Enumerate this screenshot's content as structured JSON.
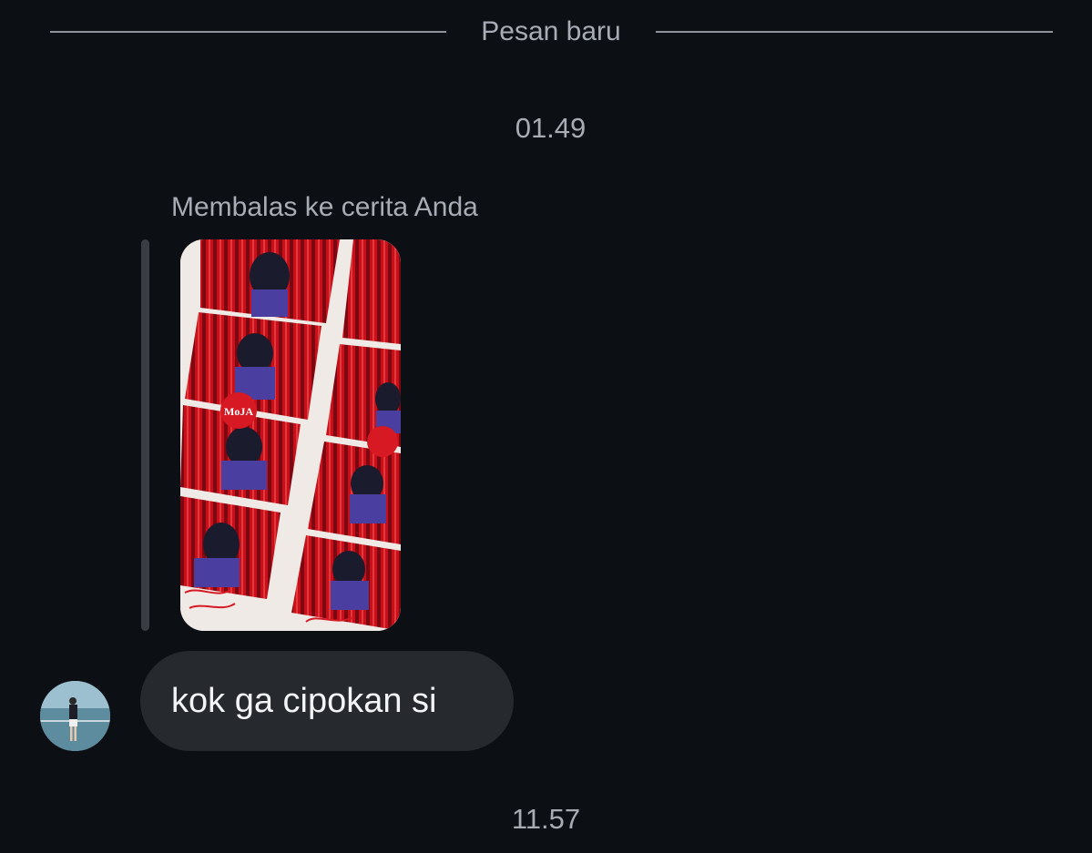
{
  "chat": {
    "new_messages_divider": "Pesan baru",
    "first_timestamp": "01.49",
    "reply_caption": "Membalas ke cerita Anda",
    "story_reply": {
      "story_thumbnail": "photobooth-strip-image",
      "story_overlay_text": "MoJA",
      "message_text": "kok ga cipokan si"
    },
    "second_timestamp": "11.57"
  },
  "colors": {
    "background": "#0c0f14",
    "secondary_text": "#a8adb5",
    "bubble": "#26292e",
    "bubble_text": "#f3f4f6",
    "reply_bar": "#3a3d43",
    "curtain_red": "#c8101c"
  },
  "icons": {
    "sender_avatar": "avatar-photo"
  }
}
